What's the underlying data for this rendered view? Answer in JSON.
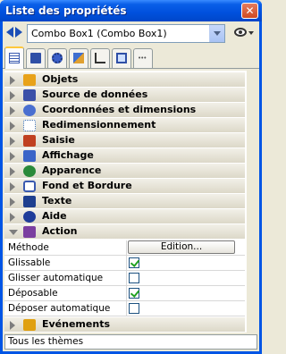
{
  "window": {
    "title": "Liste des propriétés",
    "close_glyph": "✕"
  },
  "selector": {
    "value": "Combo Box1 (Combo Box1)"
  },
  "tabs": [
    {
      "icon": "list-icon",
      "active": true
    },
    {
      "icon": "floppy-icon"
    },
    {
      "icon": "gear-icon"
    },
    {
      "icon": "shapes-icon"
    },
    {
      "icon": "chart-icon"
    },
    {
      "icon": "monitor-icon"
    },
    {
      "icon": "more-icon",
      "glyph": "•••"
    }
  ],
  "categories": [
    {
      "label": "Objets",
      "icon": "cube-icon",
      "color": "#e8a21a"
    },
    {
      "label": "Source de données",
      "icon": "database-icon",
      "color": "#3a4fa8"
    },
    {
      "label": "Coordonnées et dimensions",
      "icon": "crosshair-icon",
      "color": "#4a6fd0"
    },
    {
      "label": "Redimensionnement",
      "icon": "resize-icon",
      "color": "#3b6fb0"
    },
    {
      "label": "Saisie",
      "icon": "user-input-icon",
      "color": "#c04020"
    },
    {
      "label": "Affichage",
      "icon": "display-icon",
      "color": "#3a64c8"
    },
    {
      "label": "Apparence",
      "icon": "eye-icon",
      "color": "#2a8a3a"
    },
    {
      "label": "Fond et Bordure",
      "icon": "frame-icon",
      "color": "#3a5ab0"
    },
    {
      "label": "Texte",
      "icon": "text-icon",
      "color": "#1e3f8f"
    },
    {
      "label": "Aide",
      "icon": "help-icon",
      "color": "#1f3c9a"
    },
    {
      "label": "Action",
      "icon": "action-icon",
      "color": "#7b3fa0"
    }
  ],
  "action_props": {
    "methode": {
      "label": "Méthode",
      "button": "Edition..."
    },
    "glissable": {
      "label": "Glissable",
      "checked": true
    },
    "glisser_auto": {
      "label": "Glisser automatique",
      "checked": false
    },
    "deposable": {
      "label": "Déposable",
      "checked": true
    },
    "deposer_auto": {
      "label": "Déposer automatique",
      "checked": false
    }
  },
  "events_category": {
    "label": "Evénements",
    "icon": "event-icon",
    "color": "#e0a010"
  },
  "footer": {
    "label": "Tous les thèmes"
  }
}
